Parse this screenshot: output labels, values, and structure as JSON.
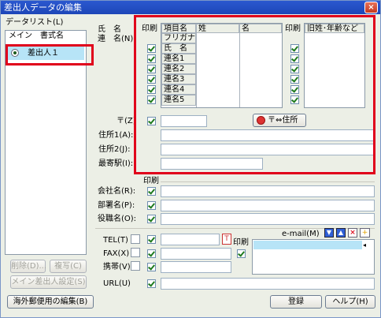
{
  "window": {
    "title": "差出人データの編集",
    "close_glyph": "×"
  },
  "data_list": {
    "label": "データリスト(L)",
    "col_main": "メイン",
    "col_name": "書式名",
    "items": [
      {
        "label": "差出人１"
      }
    ]
  },
  "left_buttons": {
    "delete": "削除(D)...",
    "copy": "複写(C)",
    "main_setting": "メイン差出人設定(S)"
  },
  "bottom_buttons": {
    "overseas": "海外郵便用の編集(B)",
    "register": "登録",
    "help": "ヘルプ(H)"
  },
  "name_section": {
    "label_line1": "氏　名",
    "label_line2": "連　名(N):",
    "print_header": "印刷",
    "grid_headers": {
      "item": "項目名",
      "sei": "姓",
      "mei": "名"
    },
    "rows": [
      "フリガナ",
      "氏　名",
      "連名1",
      "連名2",
      "連名3",
      "連名4",
      "連名5"
    ],
    "old_print_header": "印刷",
    "old_header": "旧姓･年齢など"
  },
  "address": {
    "postal_label": "〒(Z)",
    "button": "〒⇔住所",
    "address1_label": "住所1(A):",
    "address2_label": "住所2(J):",
    "station_label": "最寄駅(I):"
  },
  "company": {
    "print_header": "印刷",
    "company_label": "会社名(R):",
    "dept_label": "部署名(P):",
    "title_label": "役職名(O):"
  },
  "contact": {
    "tel_label": "TEL(T)",
    "fax_label": "FAX(X)",
    "mobile_label": "携帯(V)",
    "print_label": "印刷",
    "email_label": "e-mail(M)",
    "url_label": "URL(U)"
  },
  "colors": {
    "highlight_border": "#e0001b",
    "title_bar": "#2b58cf",
    "selection": "#b7e4f7"
  }
}
